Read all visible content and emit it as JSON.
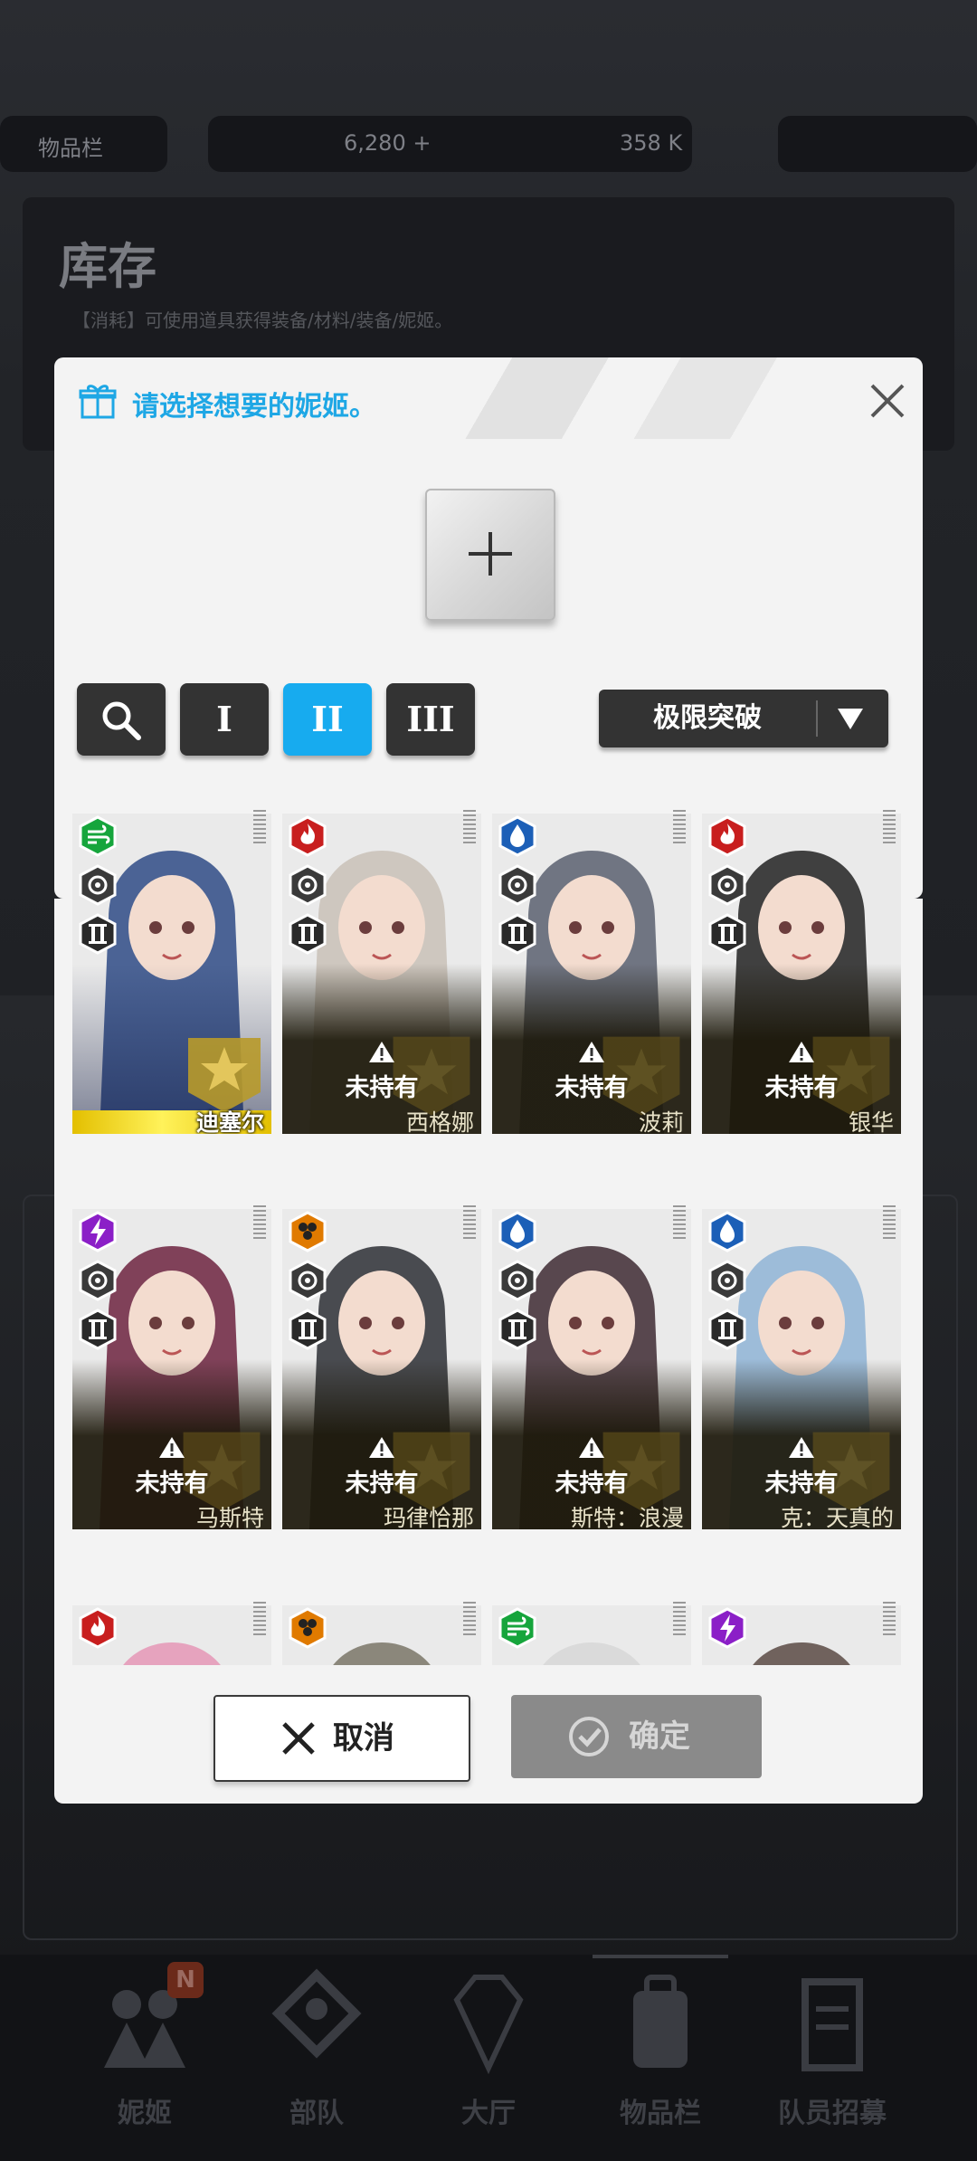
{
  "background": {
    "items_tab": "物品栏",
    "resource_1": "6,280 +",
    "resource_2": "358 K",
    "inventory_title": "库存",
    "inventory_subtitle": "【消耗】可使用道具获得装备/材料/装备/妮姬。"
  },
  "modal": {
    "title": "请选择想要的妮姬。",
    "filters": [
      "I",
      "II",
      "III"
    ],
    "active_filter": "II",
    "sort_label": "极限突破",
    "cancel_label": "取消",
    "confirm_label": "确定"
  },
  "cards": [
    {
      "name": "迪塞尔",
      "element": "wind",
      "owned": true
    },
    {
      "name": "西格娜",
      "element": "fire",
      "status": "未持有"
    },
    {
      "name": "波莉",
      "element": "water",
      "status": "未持有"
    },
    {
      "name": "银华",
      "element": "fire",
      "status": "未持有"
    },
    {
      "name": "马斯特",
      "element": "electric",
      "status": "未持有"
    },
    {
      "name": "玛律恰那",
      "element": "iron",
      "status": "未持有"
    },
    {
      "name": "斯特：浪漫",
      "element": "water",
      "status": "未持有"
    },
    {
      "name": "克：天真的",
      "element": "water",
      "status": "未持有"
    },
    {
      "element": "fire"
    },
    {
      "element": "iron"
    },
    {
      "element": "wind"
    },
    {
      "element": "electric"
    }
  ],
  "colors": {
    "accent": "#17abef",
    "fire": "#c81e1e",
    "water": "#1c5fb7",
    "wind": "#16a53c",
    "electric": "#8b1fc7",
    "iron": "#e07a00"
  },
  "nav": [
    "妮姬",
    "部队",
    "大厅",
    "物品栏",
    "队员招募"
  ],
  "nav_badge": "N"
}
